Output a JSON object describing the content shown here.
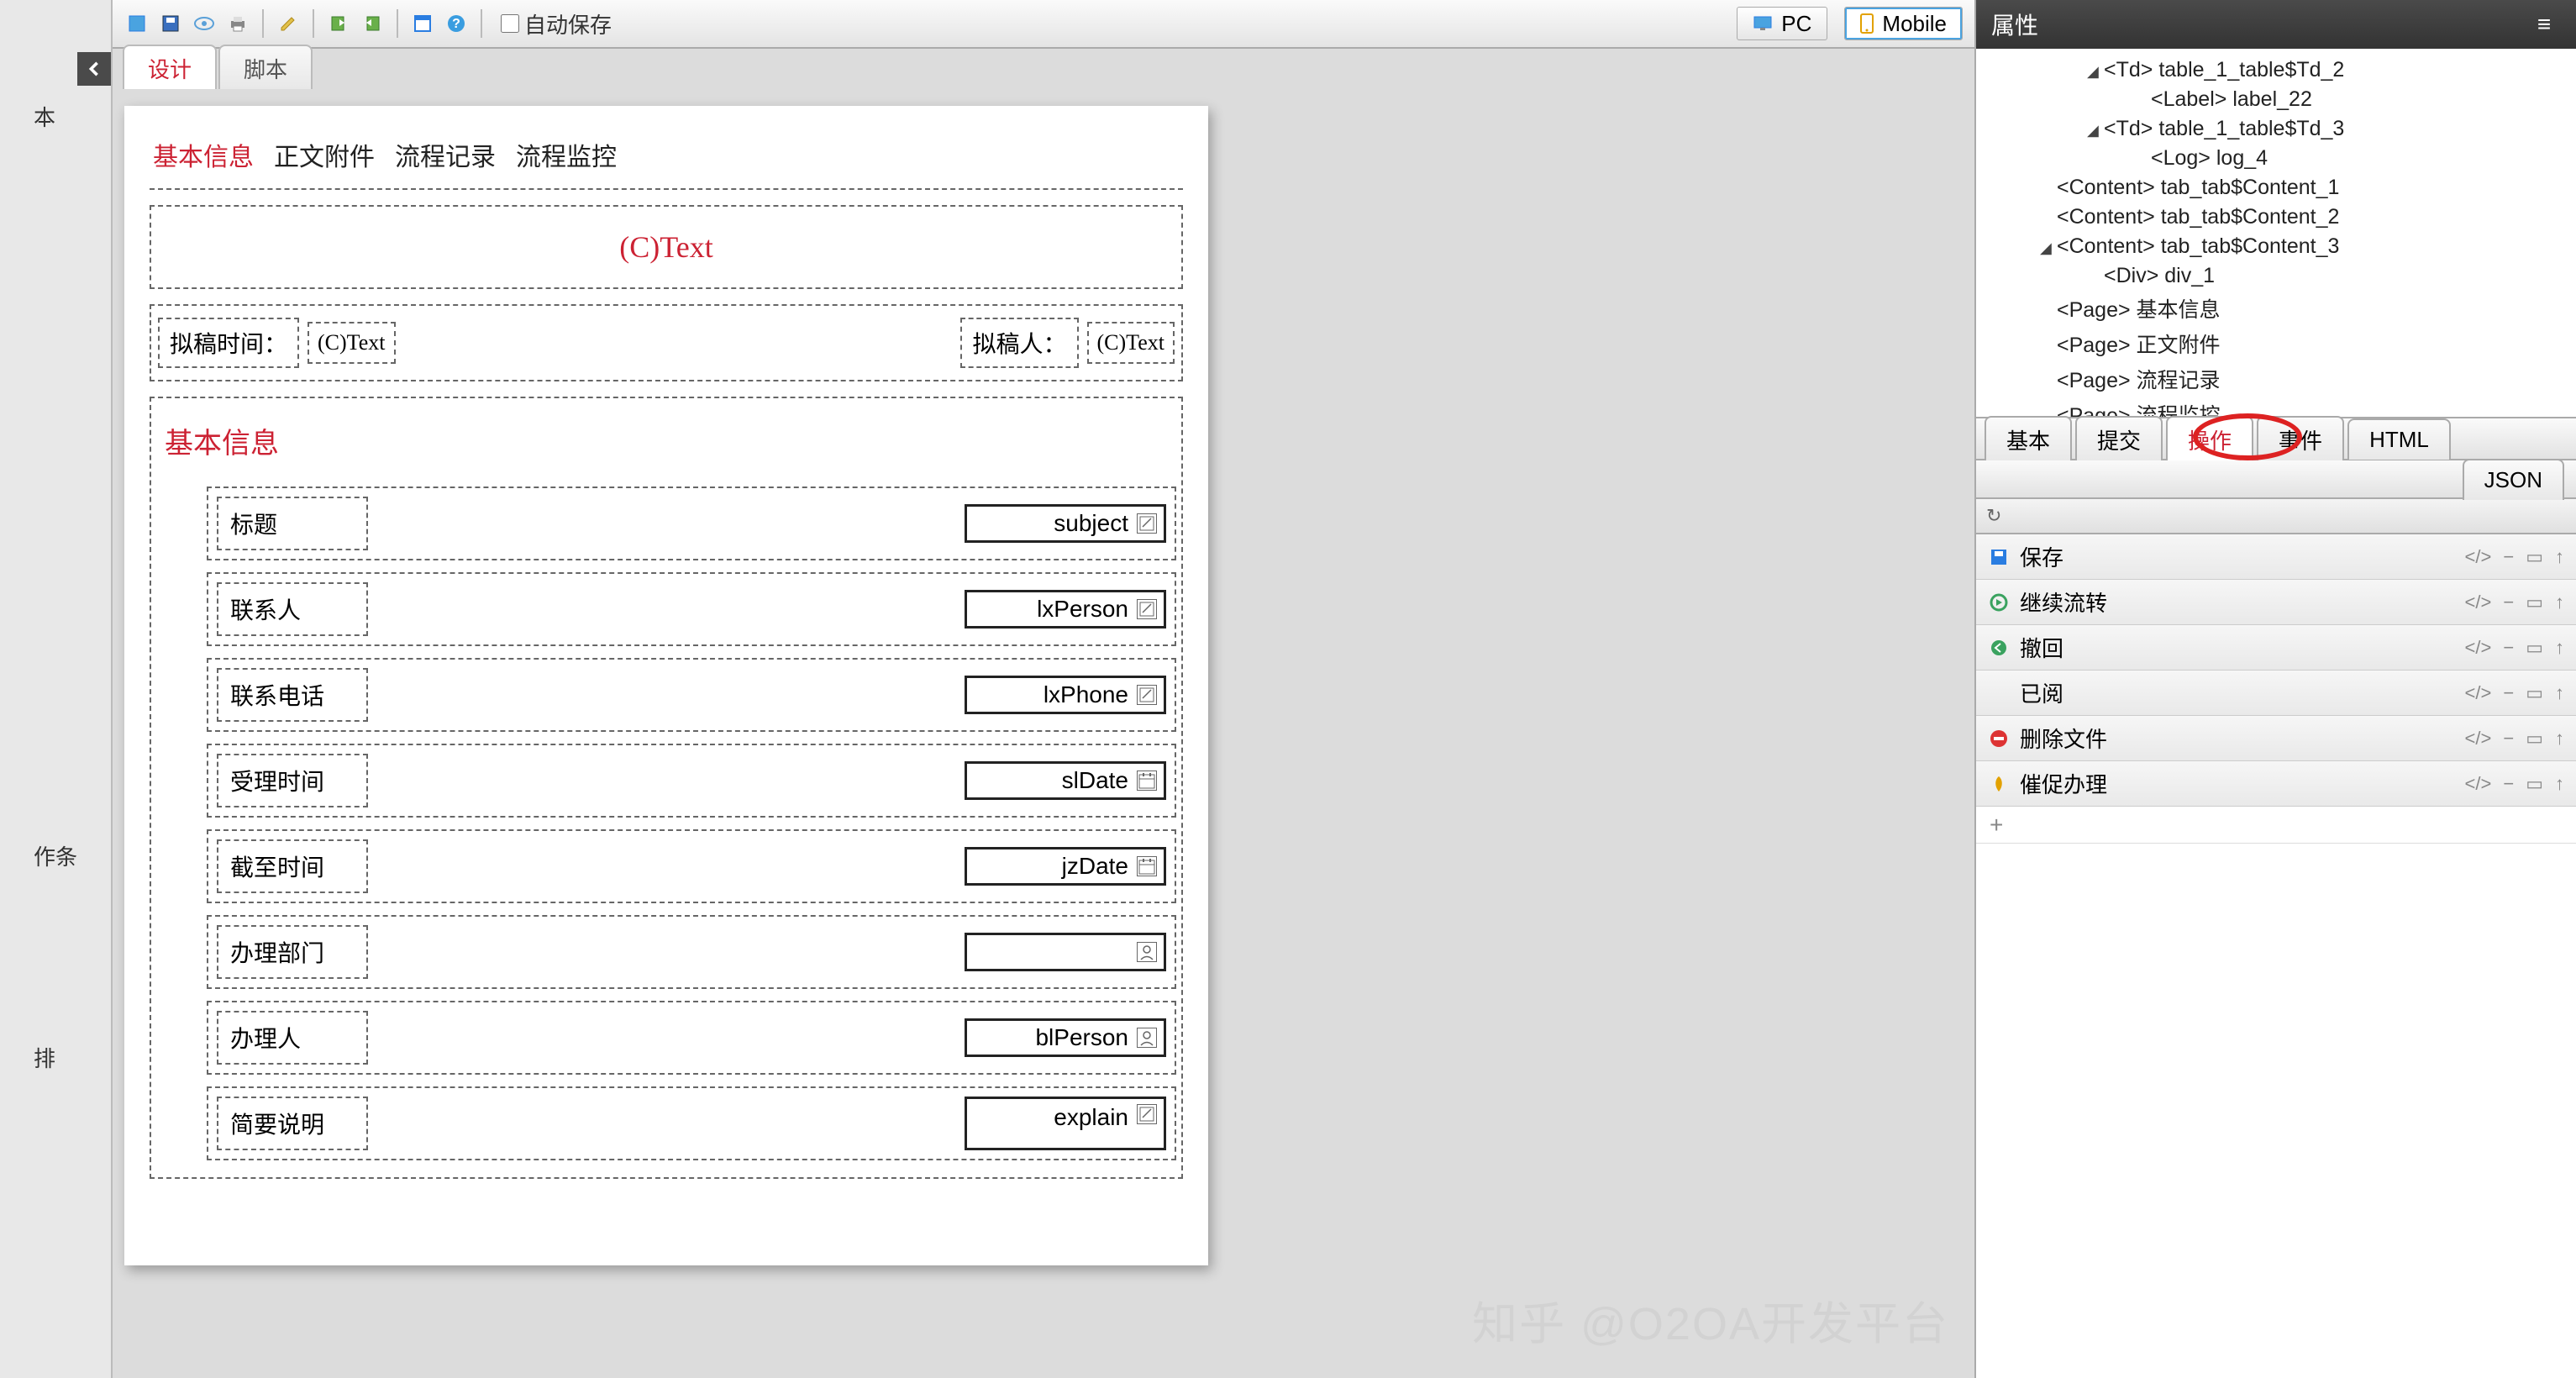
{
  "leftBar": {
    "text1": "本",
    "text2": "作条",
    "text3": "排"
  },
  "toolbar": {
    "autosave_label": "自动保存",
    "pc_label": "PC",
    "mobile_label": "Mobile"
  },
  "secTabs": {
    "design": "设计",
    "script": "脚本"
  },
  "form": {
    "tabs": {
      "basic": "基本信息",
      "attach": "正文附件",
      "log": "流程记录",
      "monitor": "流程监控"
    },
    "title_placeholder": "(C)Text",
    "draft_time_label": "拟稿时间：",
    "draft_time_value": "(C)Text",
    "drafter_label": "拟稿人：",
    "drafter_value": "(C)Text",
    "section_title": "基本信息",
    "fields": [
      {
        "label": "标题",
        "name": "subject",
        "icon": "edit"
      },
      {
        "label": "联系人",
        "name": "lxPerson",
        "icon": "edit"
      },
      {
        "label": "联系电话",
        "name": "lxPhone",
        "icon": "edit"
      },
      {
        "label": "受理时间",
        "name": "slDate",
        "icon": "date"
      },
      {
        "label": "截至时间",
        "name": "jzDate",
        "icon": "date"
      },
      {
        "label": "办理部门",
        "name": "",
        "icon": "person"
      },
      {
        "label": "办理人",
        "name": "blPerson",
        "icon": "person"
      },
      {
        "label": "简要说明",
        "name": "explain",
        "icon": "edit",
        "tall": true
      }
    ]
  },
  "rightPanel": {
    "header": "属性",
    "tree": [
      {
        "indent": 4,
        "arrow": "◢",
        "text": "<Td> table_1_table$Td_2",
        "cut": true
      },
      {
        "indent": 6,
        "arrow": "",
        "text": "<Label> label_22"
      },
      {
        "indent": 4,
        "arrow": "◢",
        "text": "<Td> table_1_table$Td_3"
      },
      {
        "indent": 6,
        "arrow": "",
        "text": "<Log> log_4"
      },
      {
        "indent": 2,
        "arrow": "",
        "text": "<Content> tab_tab$Content_1"
      },
      {
        "indent": 2,
        "arrow": "",
        "text": "<Content> tab_tab$Content_2"
      },
      {
        "indent": 2,
        "arrow": "◢",
        "text": "<Content> tab_tab$Content_3"
      },
      {
        "indent": 4,
        "arrow": "",
        "text": "<Div> div_1"
      },
      {
        "indent": 2,
        "arrow": "",
        "text": "<Page> 基本信息"
      },
      {
        "indent": 2,
        "arrow": "",
        "text": "<Page> 正文附件"
      },
      {
        "indent": 2,
        "arrow": "",
        "text": "<Page> 流程记录"
      },
      {
        "indent": 2,
        "arrow": "",
        "text": "<Page> 流程监控"
      }
    ],
    "propTabs": {
      "basic": "基本",
      "submit": "提交",
      "action": "操作",
      "event": "事件",
      "html": "HTML",
      "json": "JSON"
    },
    "ops": [
      {
        "icon": "save",
        "color": "#2a7de1",
        "label": "保存"
      },
      {
        "icon": "flow",
        "color": "#3aa25f",
        "label": "继续流转"
      },
      {
        "icon": "back",
        "color": "#3aa25f",
        "label": "撤回"
      },
      {
        "icon": "read",
        "color": "",
        "label": "已阅"
      },
      {
        "icon": "delete",
        "color": "#d33",
        "label": "删除文件"
      },
      {
        "icon": "urge",
        "color": "#e2a100",
        "label": "催促办理"
      }
    ],
    "plus": "+"
  },
  "watermark": "知乎 @O2OA开发平台"
}
